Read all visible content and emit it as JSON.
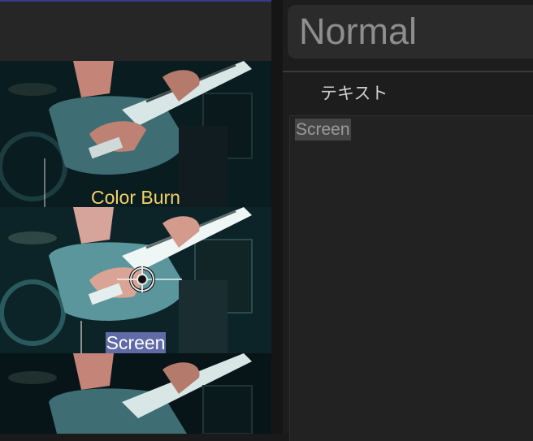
{
  "viewer": {
    "captions": {
      "color_burn": "Color Burn",
      "screen": "Screen"
    },
    "target_icon": "crosshair-icon"
  },
  "inspector": {
    "blend_mode": "Normal",
    "text_section_label": "テキスト",
    "text_value": "Screen"
  },
  "colors": {
    "caption_burn": "#f3d36a",
    "caption_selection": "#5f6aa6"
  }
}
